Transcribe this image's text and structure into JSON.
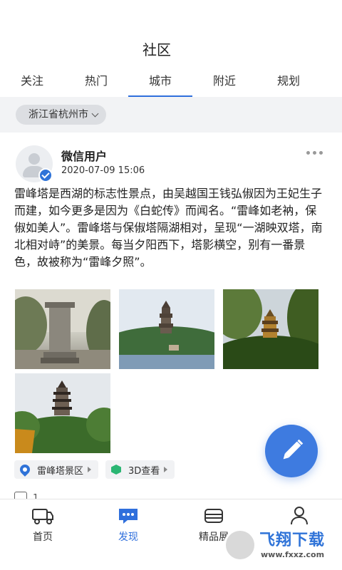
{
  "header": {
    "title": "社区"
  },
  "tabs": [
    {
      "label": "关注"
    },
    {
      "label": "热门"
    },
    {
      "label": "城市"
    },
    {
      "label": "附近"
    },
    {
      "label": "规划"
    }
  ],
  "active_tab": "城市",
  "filter": {
    "city": "浙江省杭州市"
  },
  "post": {
    "username": "微信用户",
    "timestamp": "2020-07-09 15:06",
    "content": "雷峰塔是西湖的标志性景点，由吴越国王钱弘俶因为王妃生子而建，如今更多是因为《白蛇传》而闻名。“雷峰如老衲，保俶如美人”。雷峰塔与保俶塔隔湖相对，呈现“一湖映双塔，南北相对峙”的美景。每当夕阳西下，塔影横空，别有一番景色，故被称为“雷峰夕照”。",
    "tags": [
      {
        "label": "雷峰塔景区",
        "icon": "location-pin-icon"
      },
      {
        "label": "3D查看",
        "icon": "cube-3d-icon"
      }
    ],
    "like_count": "1"
  },
  "bottom_nav": [
    {
      "label": "首页",
      "icon": "truck-home-icon"
    },
    {
      "label": "发现",
      "icon": "chat-bubble-icon"
    },
    {
      "label": "精品展",
      "icon": "gallery-box-icon"
    },
    {
      "label": "",
      "icon": "user-icon"
    }
  ],
  "watermark": {
    "main": "飞翔下载",
    "url": "www.fxxz.com"
  },
  "colors": {
    "accent": "#2f6fdc",
    "fab": "#3e7be0",
    "tag_green": "#2bb673"
  }
}
